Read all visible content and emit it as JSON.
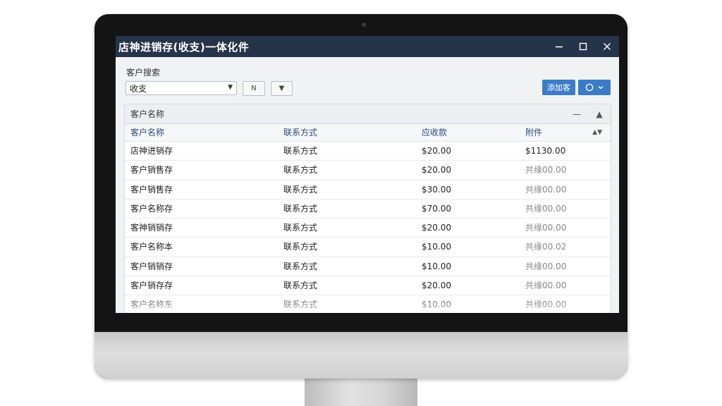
{
  "window": {
    "title": "店神进销存(收支)一体化件"
  },
  "filter": {
    "label": "客户搜索",
    "selected": "收支",
    "nav_button": "N"
  },
  "actions": {
    "primary_label": "添加客"
  },
  "grid": {
    "group_title": "客户名称",
    "columns": [
      "客户名称",
      "联系方式",
      "应收款",
      "附件"
    ],
    "rows": [
      {
        "name": "店神进销存",
        "contact": "联系方式",
        "receivable": "$20.00",
        "extra": "$1130.00"
      },
      {
        "name": "客户销售存",
        "contact": "联系方式",
        "receivable": "$20.00",
        "extra": "共缘00.00"
      },
      {
        "name": "客户销售存",
        "contact": "联系方式",
        "receivable": "$30.00",
        "extra": "共缘00.00"
      },
      {
        "name": "客户名称存",
        "contact": "联系方式",
        "receivable": "$70.00",
        "extra": "共缘00.00"
      },
      {
        "name": "客神销销存",
        "contact": "联系方式",
        "receivable": "$20.00",
        "extra": "共缘00.00"
      },
      {
        "name": "客户名称本",
        "contact": "联系方式",
        "receivable": "$10.00",
        "extra": "共缘00.02"
      },
      {
        "name": "客户销销存",
        "contact": "联系方式",
        "receivable": "$10.00",
        "extra": "共缘00.00"
      },
      {
        "name": "客户销存存",
        "contact": "联系方式",
        "receivable": "$20.00",
        "extra": "共缘00.00"
      },
      {
        "name": "客户名称东",
        "contact": "联系方式",
        "receivable": "$10.00",
        "extra": "共缘00.00"
      }
    ]
  },
  "colors": {
    "titlebar": "#253448",
    "accent": "#3c7cc6",
    "header_text": "#2c4a7c"
  }
}
